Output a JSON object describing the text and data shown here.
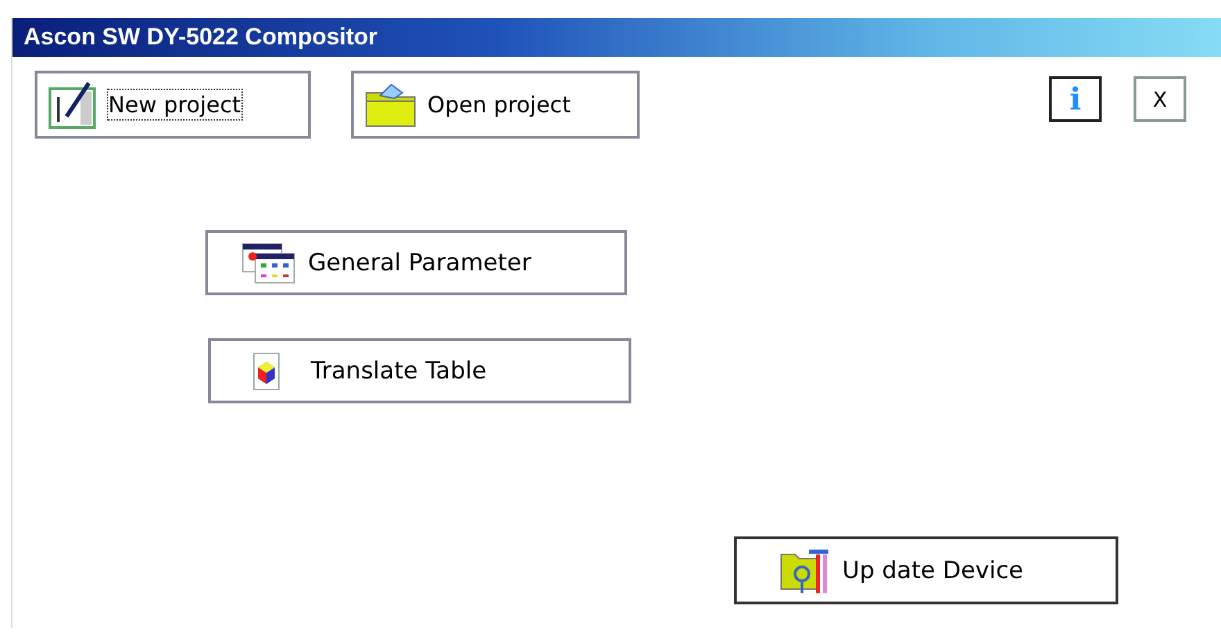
{
  "window": {
    "title": "Ascon SW DY-5022 Compositor"
  },
  "toolbar": {
    "buttons": [
      {
        "label": "New project",
        "focused": true
      },
      {
        "label": "Open project",
        "focused": false
      }
    ],
    "info_button": {
      "label": "i"
    },
    "close_button": {
      "label": "X"
    }
  },
  "actions": [
    {
      "label": "General Parameter"
    },
    {
      "label": "Translate Table"
    }
  ],
  "update_button": {
    "label": "Up date Device"
  }
}
